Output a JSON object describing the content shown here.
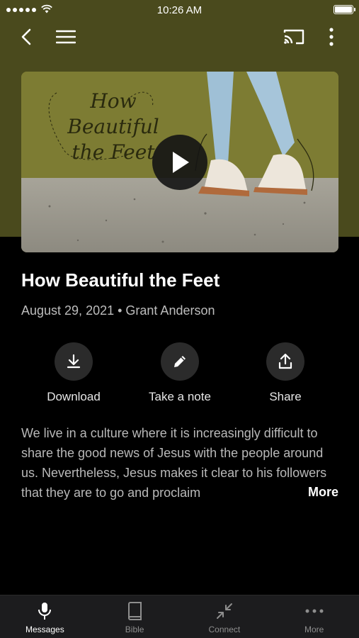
{
  "status_bar": {
    "time": "10:26 AM"
  },
  "header": {
    "back_icon": "chevron-left-icon",
    "menu_icon": "hamburger-icon",
    "cast_icon": "cast-icon",
    "overflow_icon": "more-vertical-icon"
  },
  "hero": {
    "artwork_title": "How Beautiful the Feet",
    "play_icon": "play-icon"
  },
  "message": {
    "title": "How Beautiful the Feet",
    "meta": "August 29, 2021 • Grant Anderson",
    "description": "We live in a culture where it is increasingly difficult to share the good news of Jesus with the people around us. Nevertheless, Jesus makes it clear to his followers that they are to go and proclaim",
    "more_label": "More"
  },
  "actions": [
    {
      "label": "Download",
      "icon": "download-icon"
    },
    {
      "label": "Take a note",
      "icon": "pencil-icon"
    },
    {
      "label": "Share",
      "icon": "share-icon"
    }
  ],
  "tabs": [
    {
      "label": "Messages",
      "icon": "microphone-icon",
      "active": true
    },
    {
      "label": "Bible",
      "icon": "book-icon",
      "active": false
    },
    {
      "label": "Connect",
      "icon": "connect-icon",
      "active": false
    },
    {
      "label": "More",
      "icon": "more-horizontal-icon",
      "active": false
    }
  ],
  "colors": {
    "header_bg": "#4a4a1d",
    "background": "#000000",
    "tabbar_bg": "#1c1c1e",
    "artwork_bg": "#7e7d36"
  }
}
